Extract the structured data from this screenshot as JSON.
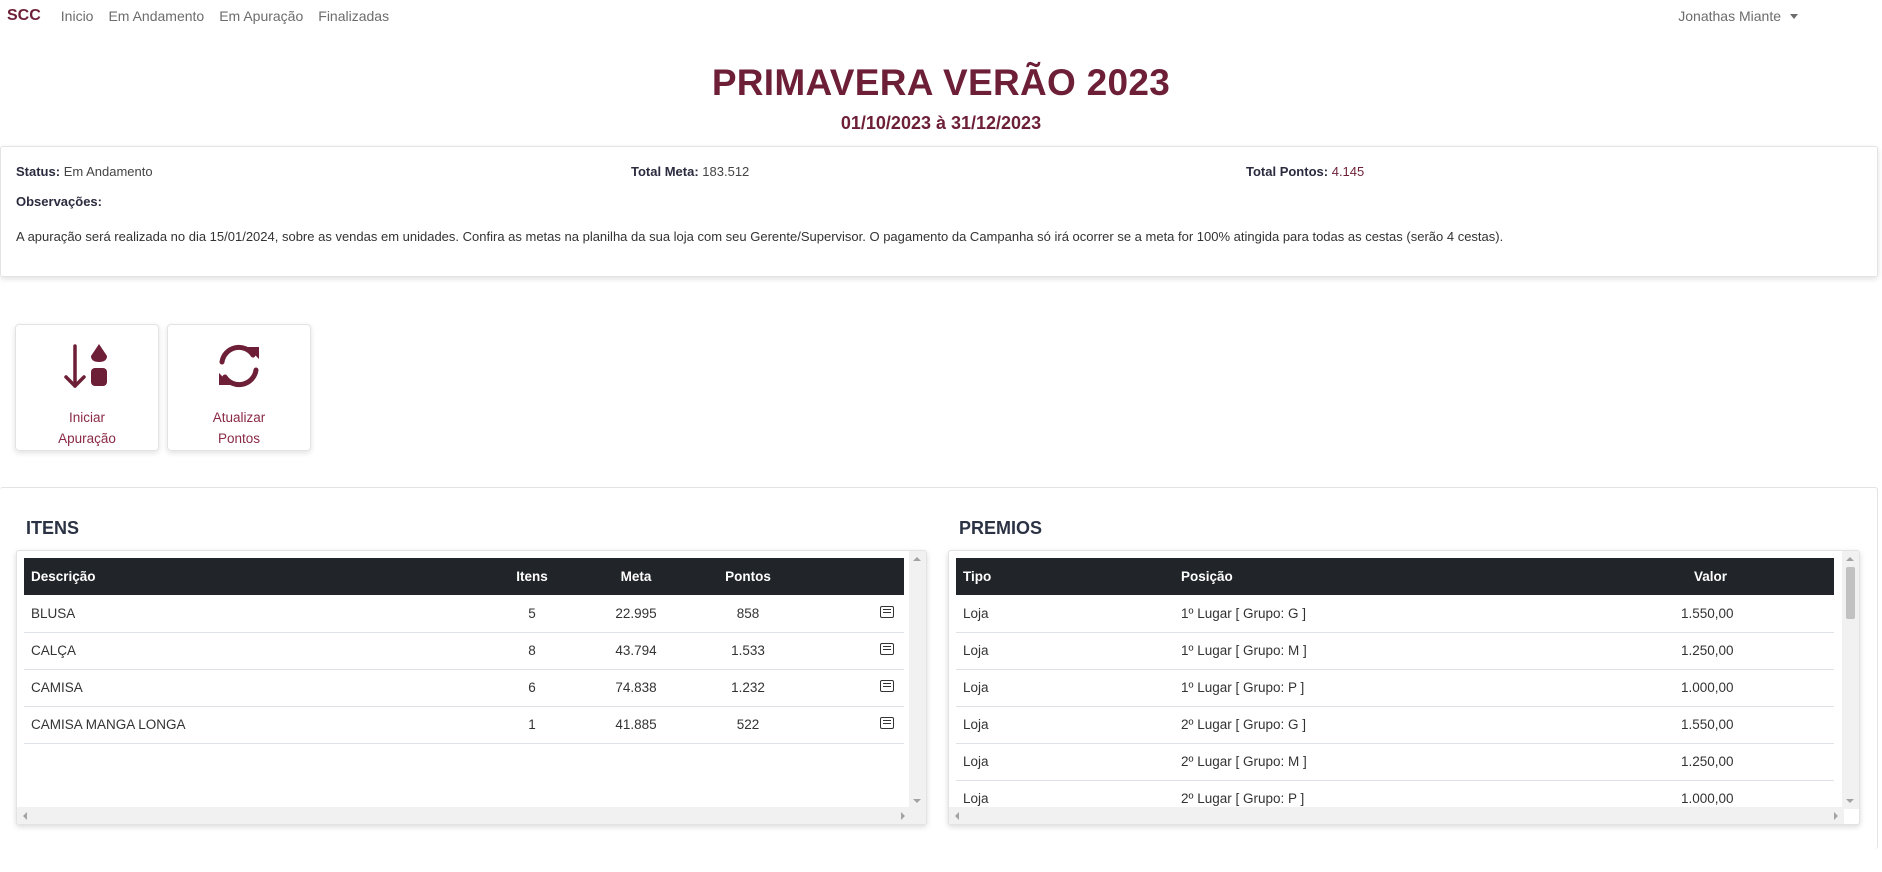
{
  "nav": {
    "brand": "SCC",
    "links": [
      "Inicio",
      "Em Andamento",
      "Em Apuração",
      "Finalizadas"
    ],
    "user": "Jonathas Miante"
  },
  "campaign": {
    "title": "PRIMAVERA VERÃO 2023",
    "period": "01/10/2023 à 31/12/2023"
  },
  "info": {
    "status_label": "Status:",
    "status_value": "Em Andamento",
    "meta_label": "Total Meta:",
    "meta_value": "183.512",
    "pontos_label": "Total Pontos:",
    "pontos_value": "4.145",
    "obs_label": "Observações:",
    "obs_text": "A apuração será realizada no dia 15/01/2024, sobre as vendas em unidades. Confira as metas na planilha da sua loja com seu Gerente/Supervisor. O pagamento da Campanha só irá ocorrer se a meta for 100% atingida para todas as cestas (serão 4 cestas)."
  },
  "actions": {
    "iniciar_line1": "Iniciar",
    "iniciar_line2": "Apuração",
    "atualizar_line1": "Atualizar",
    "atualizar_line2": "Pontos"
  },
  "colors": {
    "accent": "#6d1f37",
    "header_bg": "#212529"
  },
  "itens": {
    "title": "ITENS",
    "columns": [
      "Descrição",
      "Itens",
      "Meta",
      "Pontos"
    ],
    "rows": [
      [
        "BLUSA",
        "5",
        "22.995",
        "858"
      ],
      [
        "CALÇA",
        "8",
        "43.794",
        "1.533"
      ],
      [
        "CAMISA",
        "6",
        "74.838",
        "1.232"
      ],
      [
        "CAMISA MANGA LONGA",
        "1",
        "41.885",
        "522"
      ]
    ]
  },
  "premios": {
    "title": "PREMIOS",
    "columns": [
      "Tipo",
      "Posição",
      "Valor"
    ],
    "rows": [
      [
        "Loja",
        "1º Lugar [ Grupo: G ]",
        "1.550,00"
      ],
      [
        "Loja",
        "1º Lugar [ Grupo: M ]",
        "1.250,00"
      ],
      [
        "Loja",
        "1º Lugar [ Grupo: P ]",
        "1.000,00"
      ],
      [
        "Loja",
        "2º Lugar [ Grupo: G ]",
        "1.550,00"
      ],
      [
        "Loja",
        "2º Lugar [ Grupo: M ]",
        "1.250,00"
      ],
      [
        "Loja",
        "2º Lugar [ Grupo: P ]",
        "1.000,00"
      ]
    ]
  }
}
